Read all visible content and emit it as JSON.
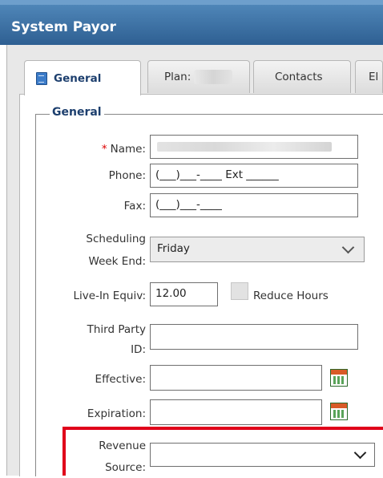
{
  "window": {
    "title": "System Payor"
  },
  "tabs": [
    {
      "label": "General",
      "active": true,
      "icon": "document-icon"
    },
    {
      "label": "Plan:",
      "active": false
    },
    {
      "label": "Contacts",
      "active": false
    },
    {
      "label": "El",
      "active": false
    }
  ],
  "section": {
    "legend": "General"
  },
  "form": {
    "name_label": "Name:",
    "required_marker": "*",
    "name_value": "",
    "phone_label": "Phone:",
    "phone_mask": "(___)___-____ Ext ______",
    "fax_label": "Fax:",
    "fax_mask": "(___)___-____",
    "scheduling_label_1": "Scheduling",
    "scheduling_label_2": "Week End:",
    "scheduling_value": "Friday",
    "live_in_label": "Live-In Equiv:",
    "live_in_value": "12.00",
    "reduce_hours_label": "Reduce Hours",
    "third_party_label_1": "Third Party",
    "third_party_label_2": "ID:",
    "third_party_value": "",
    "effective_label": "Effective:",
    "effective_value": "",
    "expiration_label": "Expiration:",
    "expiration_value": "",
    "revenue_label_1": "Revenue",
    "revenue_label_2": "Source:",
    "revenue_value": ""
  },
  "colors": {
    "title_bar": "#2e5f92",
    "highlight": "#e0001a",
    "required": "#dd0000"
  }
}
